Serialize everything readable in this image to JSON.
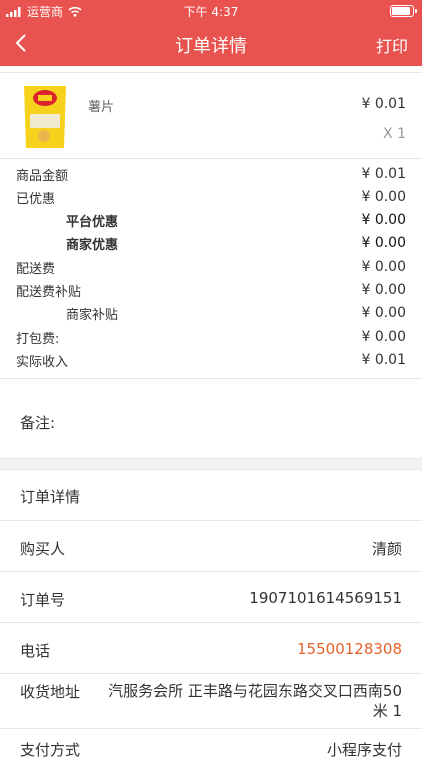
{
  "status_bar": {
    "carrier": "运营商",
    "time": "下午 4:37"
  },
  "nav": {
    "title": "订单详情",
    "print_label": "打印"
  },
  "product": {
    "name": "薯片",
    "price": "¥ 0.01",
    "qty": "X 1"
  },
  "fees": [
    {
      "label": "商品金额",
      "value": "¥ 0.01"
    },
    {
      "label": "已优惠",
      "value": "¥ 0.00"
    },
    {
      "label": "平台优惠",
      "value": "¥ 0.00"
    },
    {
      "label": "商家优惠",
      "value": "¥ 0.00"
    },
    {
      "label": "配送费",
      "value": "¥ 0.00"
    },
    {
      "label": "配送费补贴",
      "value": "¥ 0.00"
    },
    {
      "label": "商家补贴",
      "value": "¥ 0.00"
    },
    {
      "label": "打包费:",
      "value": "¥ 0.00"
    },
    {
      "label": "实际收入",
      "value": "¥ 0.01"
    }
  ],
  "remark_label": "备注:",
  "details": {
    "header": "订单详情",
    "buyer_label": "购买人",
    "buyer_value": "清颜",
    "order_no_label": "订单号",
    "order_no_value": "1907101614569151",
    "phone_label": "电话",
    "phone_value": "15500128308",
    "address_label": "收货地址",
    "address_line1": "汽服务会所 正丰路与花园东路交叉口西南50",
    "address_line2": "米 1",
    "payment_label": "支付方式",
    "payment_value": "小程序支付"
  },
  "colors": {
    "brand": "#e8534f",
    "phone": "#e8632a"
  }
}
